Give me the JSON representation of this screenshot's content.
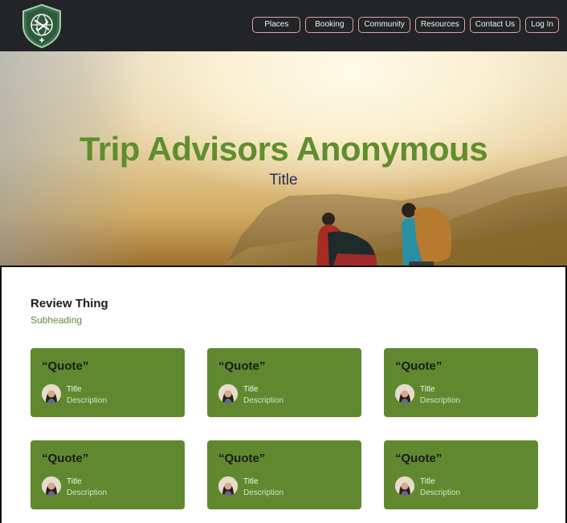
{
  "nav": {
    "items": [
      "Places",
      "Booking",
      "Community",
      "Resources",
      "Contact Us",
      "Log In"
    ]
  },
  "hero": {
    "title": "Trip Advisors Anonymous",
    "subtitle": "Title"
  },
  "reviews": {
    "heading": "Review Thing",
    "subheading": "Subheading",
    "cards": [
      {
        "quote": "“Quote”",
        "title": "Title",
        "description": "Description"
      },
      {
        "quote": "“Quote”",
        "title": "Title",
        "description": "Description"
      },
      {
        "quote": "“Quote”",
        "title": "Title",
        "description": "Description"
      },
      {
        "quote": "“Quote”",
        "title": "Title",
        "description": "Description"
      },
      {
        "quote": "“Quote”",
        "title": "Title",
        "description": "Description"
      },
      {
        "quote": "“Quote”",
        "title": "Title",
        "description": "Description"
      }
    ]
  },
  "colors": {
    "navbar": "#222427",
    "accent_green": "#60892f",
    "title_green": "#5f8e2c",
    "subtitle_navy": "#2b2b5a"
  },
  "icons": [
    "shield-globe-logo-icon",
    "avatar-portrait-icon"
  ]
}
